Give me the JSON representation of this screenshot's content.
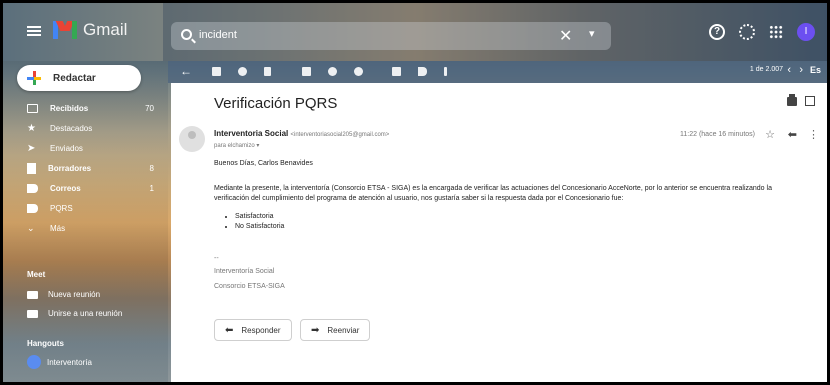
{
  "brand": {
    "name": "Gmail"
  },
  "search": {
    "query": "incident",
    "close": "✕"
  },
  "header": {
    "help_icon": "?",
    "avatar_letter": "I"
  },
  "compose": {
    "label": "Redactar"
  },
  "nav": {
    "items": [
      {
        "label": "Recibidos",
        "count": "70"
      },
      {
        "label": "Destacados",
        "count": ""
      },
      {
        "label": "Enviados",
        "count": ""
      },
      {
        "label": "Borradores",
        "count": "8"
      },
      {
        "label": "Correos",
        "count": "1"
      },
      {
        "label": "PQRS",
        "count": ""
      },
      {
        "label": "Más",
        "count": ""
      }
    ]
  },
  "meet": {
    "title": "Meet",
    "new_meeting": "Nueva reunión",
    "join_meeting": "Unirse a una reunión"
  },
  "hangouts": {
    "title": "Hangouts",
    "user": "Interventoría"
  },
  "toolbar": {
    "pager": "1 de 2.007",
    "lang": "Es"
  },
  "message": {
    "subject": "Verificación PQRS",
    "sender_name": "Interventoria Social",
    "sender_email": "<interventoriasocial205@gmail.com>",
    "to": "para elchamizo ▾",
    "time": "11:22 (hace 16 minutos)",
    "greeting": "Buenos Días, Carlos Benavides",
    "paragraph": "Mediante la presente, la interventoría (Consorcio ETSA - SIGA) es la encargada de verificar las actuaciones del Concesionario AcceNorte, por lo anterior se encuentra realizando la verificación del cumplimiento del programa de atención al usuario, nos gustaría saber si la respuesta dada por el Concesionario fue:",
    "options": [
      "Satisfactoria",
      "No Satisfactoria"
    ],
    "sig_dash": "--",
    "sig_line1": "Interventoría Social",
    "sig_line2": "Consorcio ETSA-SIGA"
  },
  "actions": {
    "reply": "Responder",
    "forward": "Reenviar"
  },
  "colors": {
    "gmail_red": "#ea4335",
    "gmail_blue": "#4285f4",
    "gmail_green": "#34a853",
    "gmail_yellow": "#fbbc04"
  }
}
